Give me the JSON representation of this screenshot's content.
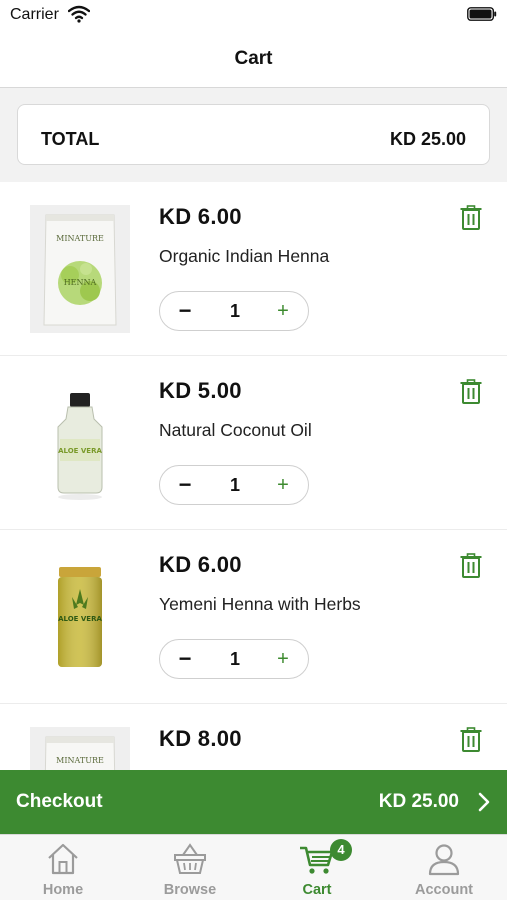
{
  "status_bar": {
    "carrier": "Carrier"
  },
  "nav": {
    "title": "Cart"
  },
  "summary": {
    "total_label": "TOTAL",
    "total_value": "KD  25.00"
  },
  "items": [
    {
      "price": "KD  6.00",
      "name": "Organic Indian Henna",
      "quantity": "1",
      "minus": "−",
      "plus": "+",
      "image": "henna-pouch"
    },
    {
      "price": "KD  5.00",
      "name": "Natural Coconut Oil",
      "quantity": "1",
      "minus": "−",
      "plus": "+",
      "image": "glass-oil-bottle"
    },
    {
      "price": "KD  6.00",
      "name": "Yemeni Henna with Herbs",
      "quantity": "1",
      "minus": "−",
      "plus": "+",
      "image": "aloe-vera-jar"
    },
    {
      "price": "KD  8.00",
      "name": "",
      "quantity": "",
      "minus": "",
      "plus": "",
      "image": "henna-pouch"
    }
  ],
  "checkout": {
    "label": "Checkout",
    "total": "KD  25.00"
  },
  "tabs": [
    {
      "label": "Home",
      "icon": "home-icon",
      "active": false
    },
    {
      "label": "Browse",
      "icon": "basket-icon",
      "active": false
    },
    {
      "label": "Cart",
      "icon": "cart-icon",
      "active": true,
      "badge": "4"
    },
    {
      "label": "Account",
      "icon": "user-icon",
      "active": false
    }
  ],
  "colors": {
    "accent": "#3d8a31",
    "inactive": "#9b9b9b",
    "background_band": "#f2f2f2"
  }
}
